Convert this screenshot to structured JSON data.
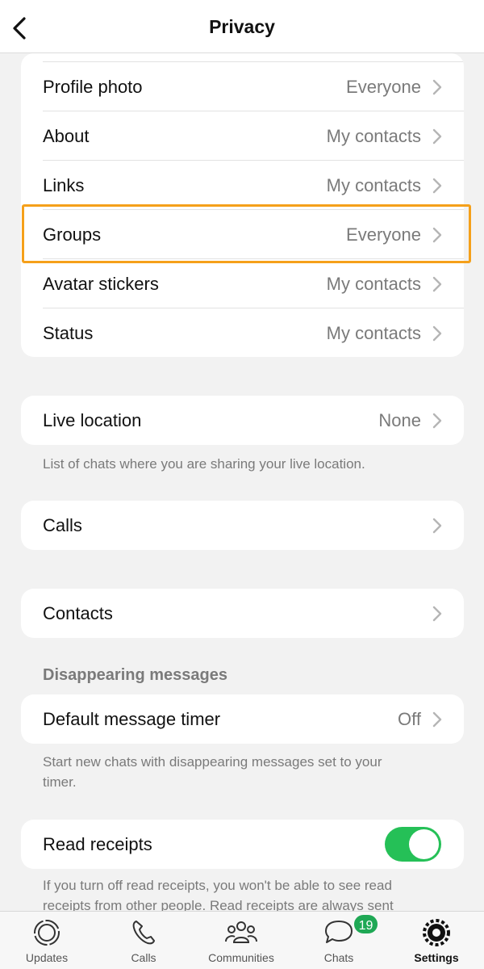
{
  "header": {
    "title": "Privacy",
    "back_icon": "chevron-left-icon"
  },
  "privacy_list": [
    {
      "label": "Profile photo",
      "value": "Everyone"
    },
    {
      "label": "About",
      "value": "My contacts"
    },
    {
      "label": "Links",
      "value": "My contacts"
    },
    {
      "label": "Groups",
      "value": "Everyone"
    },
    {
      "label": "Avatar stickers",
      "value": "My contacts"
    },
    {
      "label": "Status",
      "value": "My contacts"
    }
  ],
  "live_location": {
    "label": "Live location",
    "value": "None",
    "footnote": "List of chats where you are sharing your live location."
  },
  "calls": {
    "label": "Calls"
  },
  "contacts": {
    "label": "Contacts"
  },
  "disappearing": {
    "section_title": "Disappearing messages",
    "label": "Default message timer",
    "value": "Off",
    "footnote": "Start new chats with disappearing messages set to your timer."
  },
  "read_receipts": {
    "label": "Read receipts",
    "enabled": true,
    "footnote": "If you turn off read receipts, you won't be able to see read receipts from other people. Read receipts are always sent"
  },
  "highlight_color": "#f5a01a",
  "accent_color": "#25c057",
  "tabbar": {
    "tabs": [
      {
        "label": "Updates",
        "icon": "updates-icon"
      },
      {
        "label": "Calls",
        "icon": "phone-icon"
      },
      {
        "label": "Communities",
        "icon": "communities-icon"
      },
      {
        "label": "Chats",
        "icon": "chats-icon",
        "badge": "19"
      },
      {
        "label": "Settings",
        "icon": "gear-icon",
        "active": true
      }
    ]
  }
}
